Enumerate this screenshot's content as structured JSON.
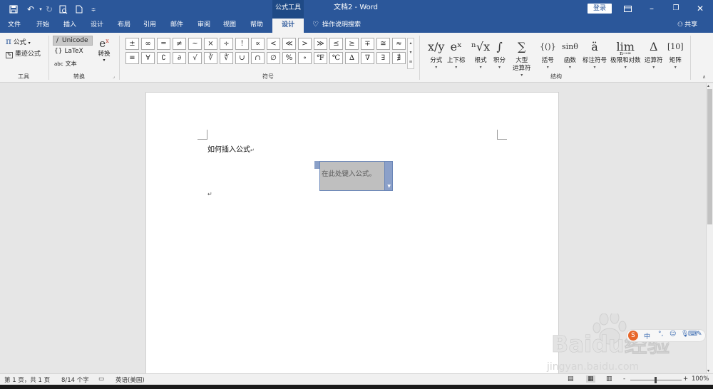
{
  "window": {
    "context_group": "公式工具",
    "title": "文档2 - Word",
    "signin": "登录",
    "colors": {
      "titlebar": "#2b579a",
      "ribbon": "#f3f3f3",
      "active_tab_text": "#2b579a"
    }
  },
  "quick_access": [
    {
      "icon": "save-icon"
    },
    {
      "icon": "undo-icon"
    },
    {
      "icon": "redo-icon"
    },
    {
      "icon": "print-preview-icon"
    },
    {
      "icon": "new-document-icon"
    },
    {
      "icon": "customize-dropdown-icon"
    }
  ],
  "window_controls": [
    {
      "icon": "ribbon-display-icon"
    },
    {
      "icon": "minimize-icon"
    },
    {
      "icon": "restore-icon"
    },
    {
      "icon": "close-icon"
    }
  ],
  "tabs": [
    {
      "label": "文件"
    },
    {
      "label": "开始"
    },
    {
      "label": "插入"
    },
    {
      "label": "设计"
    },
    {
      "label": "布局"
    },
    {
      "label": "引用"
    },
    {
      "label": "邮件"
    },
    {
      "label": "审阅"
    },
    {
      "label": "视图"
    },
    {
      "label": "帮助"
    },
    {
      "label": "设计",
      "active": true
    }
  ],
  "tell_me": "操作说明搜索",
  "share": "共享",
  "ribbon": {
    "tools": {
      "equation_icon": "π",
      "equation_label": "公式",
      "ink_label": "墨迹公式",
      "group_label": "工具"
    },
    "conversions": {
      "unicode_icon": "/",
      "unicode": "Unicode",
      "latex_icon": "{}",
      "latex": "LaTeX",
      "text_icon": "abc",
      "text": "文本",
      "convert": "转换",
      "group_label": "转换"
    },
    "symbols": {
      "group_label": "符号",
      "row1": [
        "±",
        "∞",
        "=",
        "≠",
        "~",
        "×",
        "÷",
        "!",
        "∝",
        "<",
        "≪",
        ">",
        "≫",
        "≤",
        "≥",
        "∓",
        "≅",
        "≈"
      ],
      "row2": [
        "≡",
        "∀",
        "∁",
        "∂",
        "√",
        "∛",
        "∜",
        "∪",
        "∩",
        "∅",
        "%",
        "∘",
        "℉",
        "℃",
        "∆",
        "∇",
        "∃",
        "∄"
      ]
    },
    "structures": {
      "group_label": "结构",
      "items": [
        {
          "label": "分式",
          "icon": "x/y"
        },
        {
          "label": "上下标",
          "icon": "eˣ"
        },
        {
          "label": "根式",
          "icon": "ⁿ√x"
        },
        {
          "label": "积分",
          "icon": "∫"
        },
        {
          "label": "大型",
          "label2": "运算符",
          "icon": "∑"
        },
        {
          "label": "括号",
          "icon": "{()}"
        },
        {
          "label": "函数",
          "icon": "sinθ"
        },
        {
          "label": "标注符号",
          "icon": "ä"
        },
        {
          "label": "极限和对数",
          "icon": "lim",
          "icon_sub": "n→∞"
        },
        {
          "label": "运算符",
          "icon": "Δ"
        },
        {
          "label": "矩阵",
          "icon": "[10]"
        }
      ]
    }
  },
  "document": {
    "heading": "如何插入公式",
    "equation_placeholder": "在此处键入公式。",
    "paragraph_mark": "↵"
  },
  "status": {
    "page": "第 1 页，共 1 页",
    "words": "8/14 个字",
    "language": "英语(美国)",
    "zoom": "100%",
    "zoom_minus": "-",
    "zoom_plus": "+"
  },
  "watermark": {
    "brand": "Baidu经验",
    "url": "jingyan.baidu.com"
  }
}
